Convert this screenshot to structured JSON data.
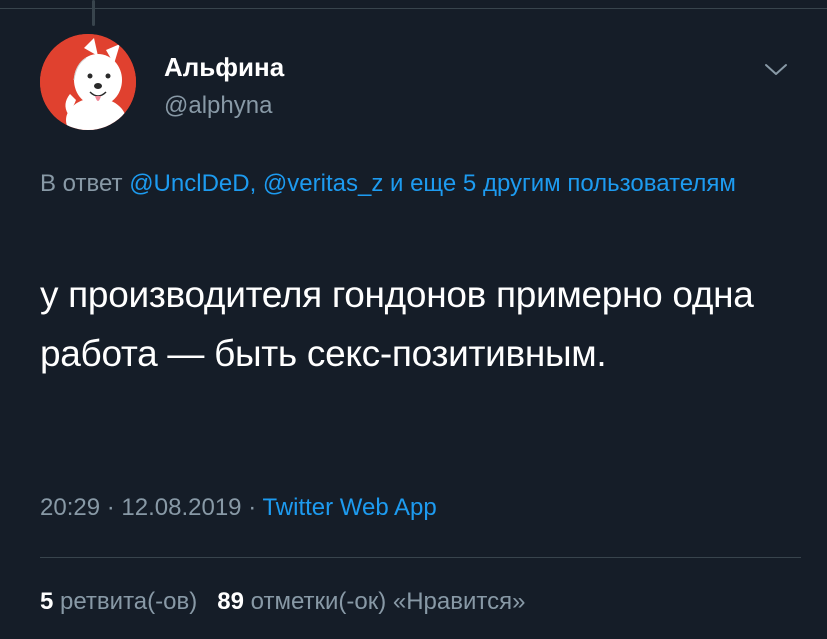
{
  "author": {
    "name": "Альфина",
    "handle": "@alphyna"
  },
  "reply": {
    "prefix": "В ответ",
    "mention1": "@UnclDeD,",
    "mention2": "@veritas_z",
    "conjunction": "и еще",
    "others": "5 другим пользователям"
  },
  "tweet": {
    "text": "у производителя гондонов примерно одна работа — быть секс-позитивным."
  },
  "meta": {
    "time": "20:29",
    "separator1": "·",
    "date": "12.08.2019",
    "separator2": "·",
    "source": "Twitter Web App"
  },
  "stats": {
    "retweets_count": "5",
    "retweets_label": "ретвита(-ов)",
    "likes_count": "89",
    "likes_label": "отметки(-ок) «Нравится»"
  },
  "colors": {
    "background": "#151d28",
    "link": "#1d9bf0",
    "secondary": "#8899a6",
    "divider": "#38444d"
  },
  "icons": {
    "avatar": "white-dog-avatar",
    "menu": "chevron-down-icon"
  }
}
